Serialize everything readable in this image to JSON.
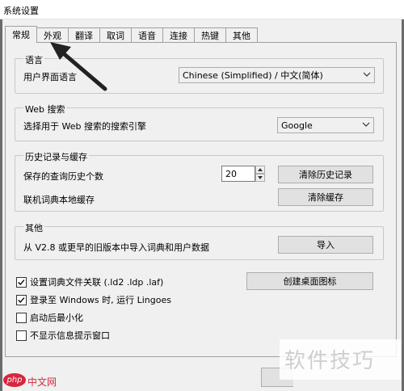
{
  "window": {
    "title": "系统设置"
  },
  "tabs": [
    "常规",
    "外观",
    "翻译",
    "取词",
    "语音",
    "连接",
    "热键",
    "其他"
  ],
  "groups": {
    "language": {
      "title": "语言",
      "ui_language_label": "用户界面语言",
      "ui_language_value": "Chinese (Simplified)  /  中文(简体)"
    },
    "web_search": {
      "title": "Web 搜索",
      "engine_label": "选择用于 Web 搜索的搜索引擎",
      "engine_value": "Google"
    },
    "history": {
      "title": "历史记录与缓存",
      "count_label": "保存的查询历史个数",
      "count_value": "20",
      "clear_history_button": "清除历史记录",
      "cache_label": "联机词典本地缓存",
      "clear_cache_button": "清除缓存"
    },
    "other": {
      "title": "其他",
      "import_label": "从 V2.8 或更早的旧版本中导入词典和用户数据",
      "import_button": "导入"
    }
  },
  "checkboxes": [
    {
      "label": "设置词典文件关联 (.ld2 .ldp .laf)",
      "checked": true
    },
    {
      "label": "登录至 Windows 时, 运行 Lingoes",
      "checked": true
    },
    {
      "label": "启动后最小化",
      "checked": false
    },
    {
      "label": "不显示信息提示窗口",
      "checked": false
    }
  ],
  "create_shortcut_button": "创建桌面图标",
  "watermark": "软件技巧",
  "logo_text": "中文网",
  "logo_badge": "php"
}
